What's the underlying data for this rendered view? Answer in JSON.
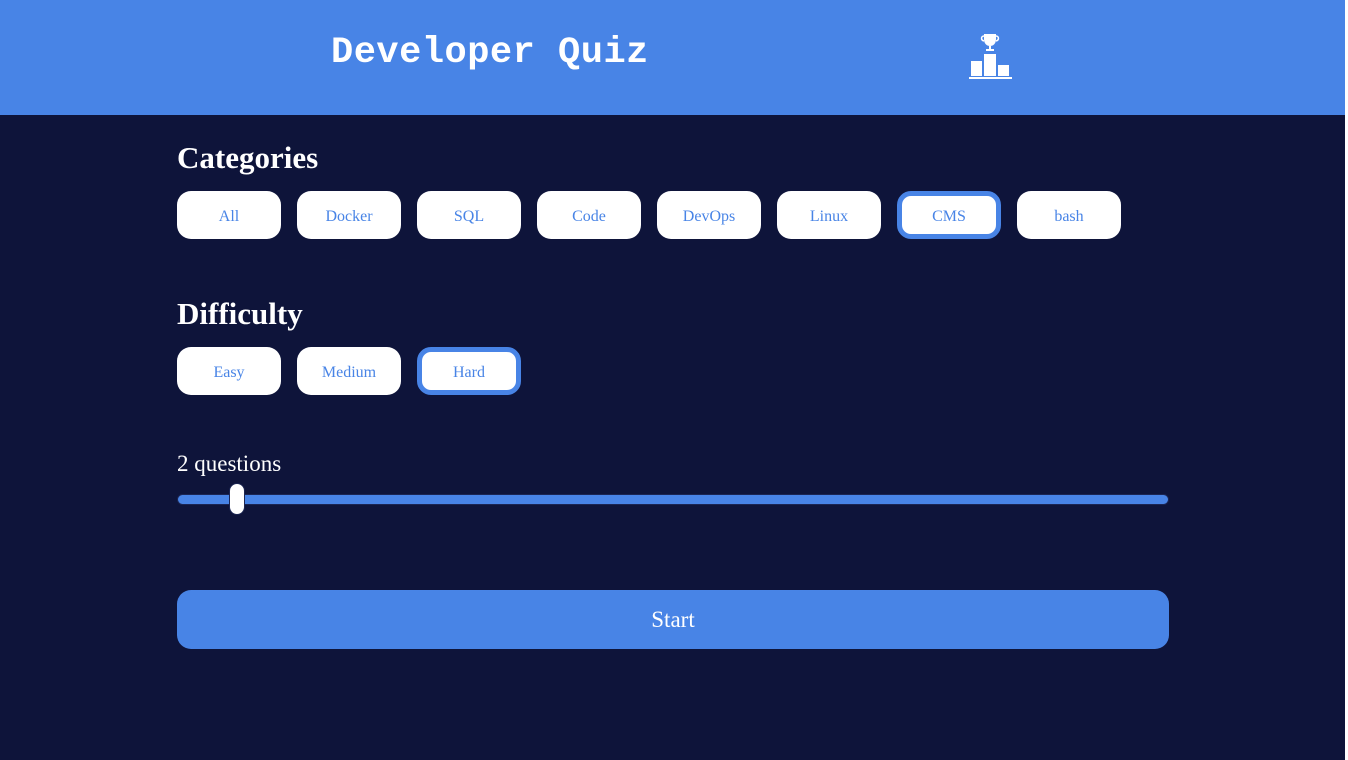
{
  "header": {
    "title": "Developer Quiz",
    "leaderboard_icon": "trophy-podium-icon"
  },
  "categories": {
    "title": "Categories",
    "items": [
      {
        "label": "All",
        "selected": false
      },
      {
        "label": "Docker",
        "selected": false
      },
      {
        "label": "SQL",
        "selected": false
      },
      {
        "label": "Code",
        "selected": false
      },
      {
        "label": "DevOps",
        "selected": false
      },
      {
        "label": "Linux",
        "selected": false
      },
      {
        "label": "CMS",
        "selected": true
      },
      {
        "label": "bash",
        "selected": false
      }
    ]
  },
  "difficulty": {
    "title": "Difficulty",
    "items": [
      {
        "label": "Easy",
        "selected": false
      },
      {
        "label": "Medium",
        "selected": false
      },
      {
        "label": "Hard",
        "selected": true
      }
    ]
  },
  "questions": {
    "label": "2 questions",
    "slider_fraction": 0.06
  },
  "start": {
    "label": "Start"
  },
  "colors": {
    "accent": "#4884e6",
    "background": "#0e143a",
    "pill_background": "#ffffff"
  }
}
